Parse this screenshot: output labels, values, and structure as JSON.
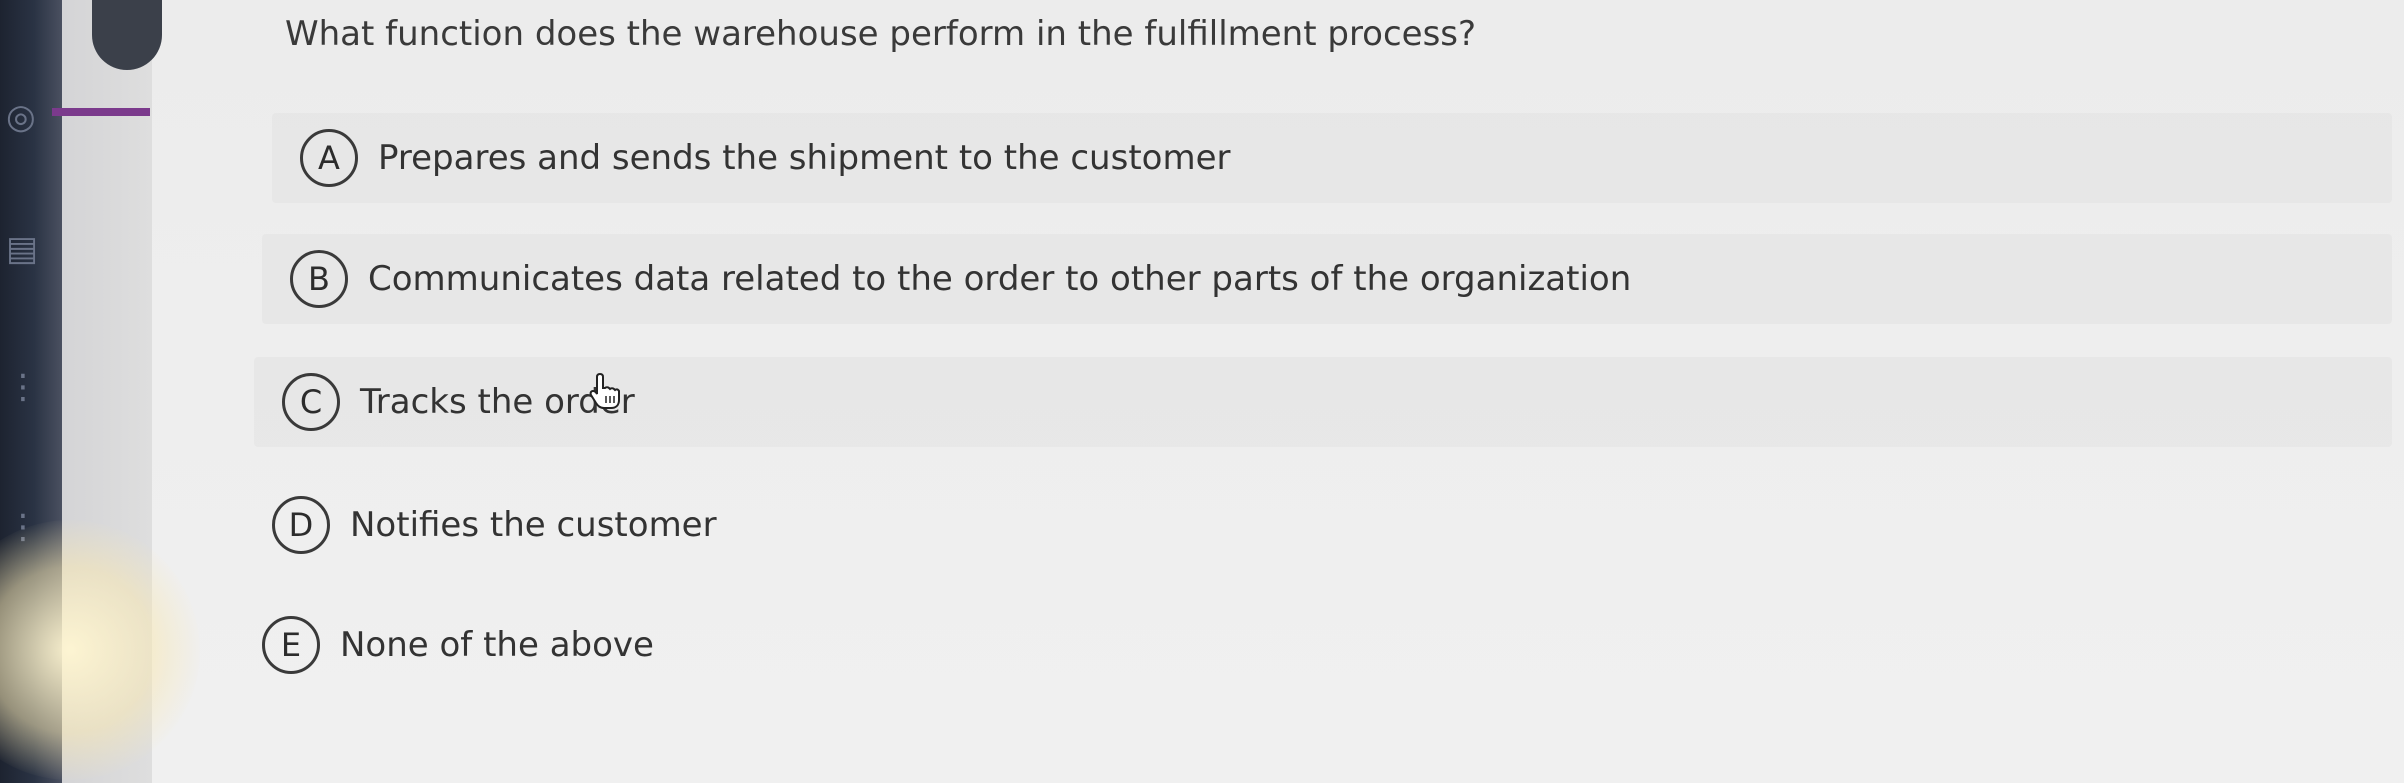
{
  "question": {
    "text": "What function does the warehouse perform in the fulfillment process?"
  },
  "options": [
    {
      "letter": "A",
      "text": "Prepares and sends the shipment to the customer"
    },
    {
      "letter": "B",
      "text": "Communicates data related to the order to other parts of the organization"
    },
    {
      "letter": "C",
      "text": "Tracks the order"
    },
    {
      "letter": "D",
      "text": "Notifies the customer"
    },
    {
      "letter": "E",
      "text": "None of the above"
    }
  ],
  "icons": {
    "cursor": "hand-pointer-icon",
    "rail_globe": "globe-icon",
    "rail_box": "document-icon"
  },
  "colors": {
    "text": "#333333",
    "rail": "#2a3344",
    "accent": "#7b3a8c"
  }
}
